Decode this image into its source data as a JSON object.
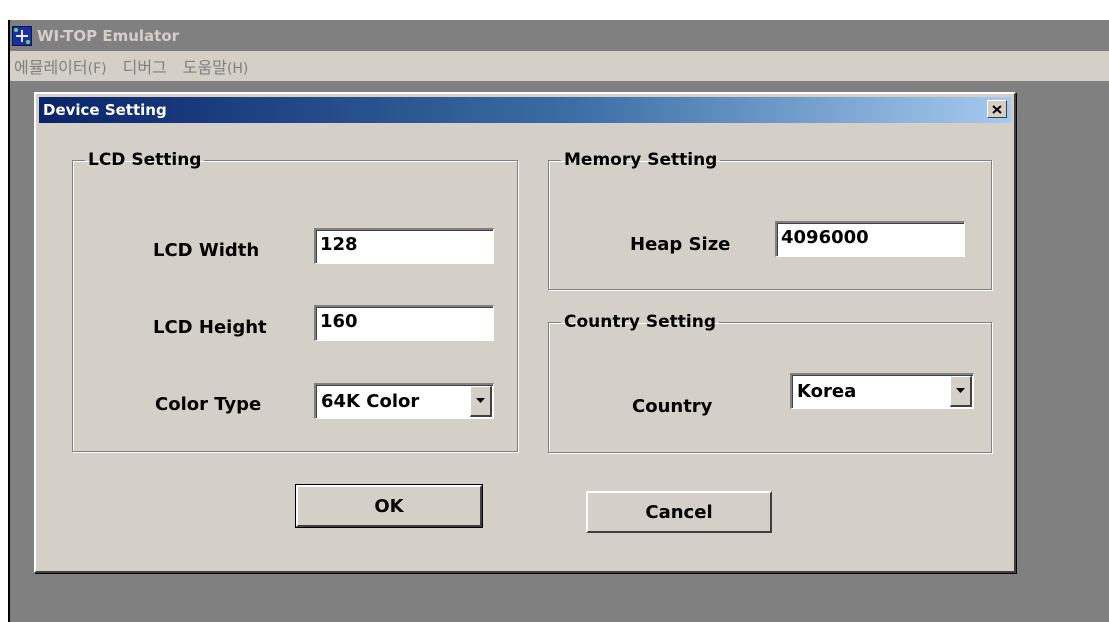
{
  "app": {
    "title": "WI-TOP Emulator",
    "menu": [
      {
        "label": "에뮬레이터",
        "accel": "(F)"
      },
      {
        "label": "디버그",
        "accel": ""
      },
      {
        "label": "도움말",
        "accel": "(H)"
      }
    ]
  },
  "dialog": {
    "title": "Device Setting",
    "lcd": {
      "legend": "LCD Setting",
      "width_label": "LCD Width",
      "width_value": "128",
      "height_label": "LCD Height",
      "height_value": "160",
      "color_label": "Color Type",
      "color_value": "64K Color"
    },
    "memory": {
      "legend": "Memory Setting",
      "heap_label": "Heap Size",
      "heap_value": "4096000"
    },
    "country": {
      "legend": "Country Setting",
      "country_label": "Country",
      "country_value": "Korea"
    },
    "ok_label": "OK",
    "cancel_label": "Cancel"
  },
  "icons": {
    "app": "app-icon",
    "close": "close-icon",
    "dropdown": "chevron-down-icon"
  },
  "colors": {
    "titlebar_start": "#0a246a",
    "titlebar_end": "#a6caf0",
    "face": "#d4d0c8",
    "desktop": "#808080"
  }
}
